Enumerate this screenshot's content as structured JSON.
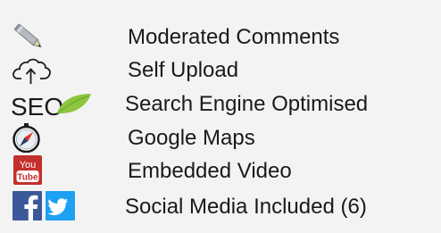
{
  "features": [
    {
      "label": "Moderated Comments",
      "icon": "pencil-icon"
    },
    {
      "label": "Self Upload",
      "icon": "cloud-upload-icon"
    },
    {
      "label": "Search Engine Optimised",
      "icon": "seo-leaf-icon",
      "icon_text": "SEO"
    },
    {
      "label": "Google Maps",
      "icon": "compass-icon"
    },
    {
      "label": "Embedded Video",
      "icon": "youtube-icon",
      "icon_text_top": "You",
      "icon_text_bottom": "Tube"
    },
    {
      "label": "Social Media Included (6)",
      "icon": "facebook-twitter-icons"
    }
  ],
  "colors": {
    "text": "#1a1a1a",
    "seo_green": "#8cc63f",
    "youtube_red": "#c4302b",
    "facebook_blue": "#3b5998",
    "twitter_blue": "#1da1f2"
  }
}
